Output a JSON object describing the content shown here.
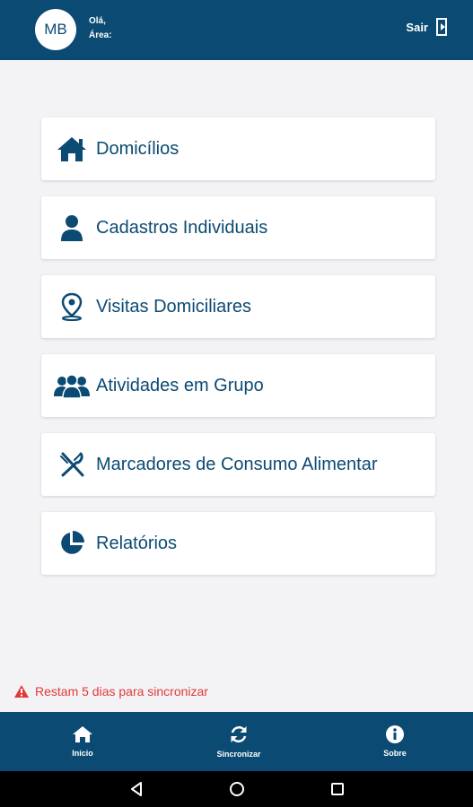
{
  "header": {
    "avatar_initials": "MB",
    "greeting": "Olá,",
    "area": "Área:",
    "logout_label": "Sair"
  },
  "menu": {
    "items": [
      {
        "label": "Domicílios",
        "icon": "home-icon"
      },
      {
        "label": "Cadastros Individuais",
        "icon": "person-icon"
      },
      {
        "label": "Visitas Domiciliares",
        "icon": "map-pin-icon"
      },
      {
        "label": "Atividades em Grupo",
        "icon": "group-icon"
      },
      {
        "label": "Marcadores de Consumo Alimentar",
        "icon": "cutlery-icon"
      },
      {
        "label": "Relatórios",
        "icon": "pie-chart-icon"
      }
    ]
  },
  "sync_warning": {
    "text": "Restam 5 dias para sincronizar",
    "icon": "warning-icon",
    "color": "#e03a3a"
  },
  "bottom_nav": {
    "tabs": [
      {
        "label": "Início",
        "icon": "home-icon"
      },
      {
        "label": "Sincronizar",
        "icon": "sync-icon"
      },
      {
        "label": "Sobre",
        "icon": "info-icon"
      }
    ]
  },
  "colors": {
    "primary": "#0b4a73",
    "background": "#f3f3f6",
    "warning": "#e03a3a"
  }
}
